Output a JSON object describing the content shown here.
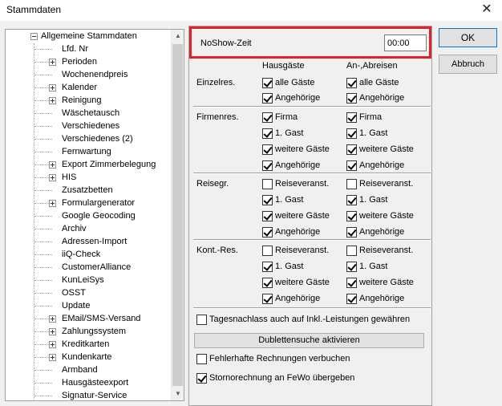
{
  "window": {
    "title": "Stammdaten",
    "close_glyph": "✕"
  },
  "tree": {
    "root": "Allgemeine Stammdaten",
    "items": [
      {
        "label": "Lfd. Nr",
        "expandable": false
      },
      {
        "label": "Perioden",
        "expandable": true
      },
      {
        "label": "Wochenendpreis",
        "expandable": false
      },
      {
        "label": "Kalender",
        "expandable": true
      },
      {
        "label": "Reinigung",
        "expandable": true
      },
      {
        "label": "Wäschetausch",
        "expandable": false
      },
      {
        "label": "Verschiedenes",
        "expandable": false
      },
      {
        "label": "Verschiedenes (2)",
        "expandable": false
      },
      {
        "label": "Fernwartung",
        "expandable": false
      },
      {
        "label": "Export Zimmerbelegung",
        "expandable": true
      },
      {
        "label": "HIS",
        "expandable": true
      },
      {
        "label": "Zusatzbetten",
        "expandable": false
      },
      {
        "label": "Formulargenerator",
        "expandable": true
      },
      {
        "label": "Google Geocoding",
        "expandable": false
      },
      {
        "label": "Archiv",
        "expandable": false
      },
      {
        "label": "Adressen-Import",
        "expandable": false
      },
      {
        "label": "iiQ-Check",
        "expandable": false
      },
      {
        "label": "CustomerAlliance",
        "expandable": false
      },
      {
        "label": "KunLeiSys",
        "expandable": false
      },
      {
        "label": "OSST",
        "expandable": false
      },
      {
        "label": "Update",
        "expandable": false
      },
      {
        "label": "EMail/SMS-Versand",
        "expandable": true
      },
      {
        "label": "Zahlungssystem",
        "expandable": true
      },
      {
        "label": "Kreditkarten",
        "expandable": true
      },
      {
        "label": "Kundenkarte",
        "expandable": true
      },
      {
        "label": "Armband",
        "expandable": false
      },
      {
        "label": "Hausgästeexport",
        "expandable": false
      },
      {
        "label": "Signatur-Service",
        "expandable": false
      }
    ]
  },
  "settings": {
    "noshow_label": "NoShow-Zeit",
    "noshow_value": "00:00",
    "col_hausgaeste": "Hausgäste",
    "col_anabreisen": "An-,Abreisen",
    "sections": [
      {
        "label": "Einzelres.",
        "rows": [
          {
            "haus": {
              "label": "alle Gäste",
              "checked": true
            },
            "an": {
              "label": "alle Gäste",
              "checked": true
            }
          },
          {
            "haus": {
              "label": "Angehörige",
              "checked": true
            },
            "an": {
              "label": "Angehörige",
              "checked": true
            }
          }
        ]
      },
      {
        "label": "Firmenres.",
        "rows": [
          {
            "haus": {
              "label": "Firma",
              "checked": true
            },
            "an": {
              "label": "Firma",
              "checked": true
            }
          },
          {
            "haus": {
              "label": "1. Gast",
              "checked": true
            },
            "an": {
              "label": "1. Gast",
              "checked": true
            }
          },
          {
            "haus": {
              "label": "weitere Gäste",
              "checked": true
            },
            "an": {
              "label": "weitere Gäste",
              "checked": true
            }
          },
          {
            "haus": {
              "label": "Angehörige",
              "checked": true
            },
            "an": {
              "label": "Angehörige",
              "checked": true
            }
          }
        ]
      },
      {
        "label": "Reisegr.",
        "rows": [
          {
            "haus": {
              "label": "Reiseveranst.",
              "checked": false
            },
            "an": {
              "label": "Reiseveranst.",
              "checked": false
            }
          },
          {
            "haus": {
              "label": "1. Gast",
              "checked": true
            },
            "an": {
              "label": "1. Gast",
              "checked": true
            }
          },
          {
            "haus": {
              "label": "weitere Gäste",
              "checked": true
            },
            "an": {
              "label": "weitere Gäste",
              "checked": true
            }
          },
          {
            "haus": {
              "label": "Angehörige",
              "checked": true
            },
            "an": {
              "label": "Angehörige",
              "checked": true
            }
          }
        ]
      },
      {
        "label": "Kont.-Res.",
        "rows": [
          {
            "haus": {
              "label": "Reiseveranst.",
              "checked": false
            },
            "an": {
              "label": "Reiseveranst.",
              "checked": false
            }
          },
          {
            "haus": {
              "label": "1. Gast",
              "checked": true
            },
            "an": {
              "label": "1. Gast",
              "checked": true
            }
          },
          {
            "haus": {
              "label": "weitere Gäste",
              "checked": true
            },
            "an": {
              "label": "weitere Gäste",
              "checked": true
            }
          },
          {
            "haus": {
              "label": "Angehörige",
              "checked": true
            },
            "an": {
              "label": "Angehörige",
              "checked": true
            }
          }
        ]
      }
    ],
    "tagesnachlass": {
      "label": "Tagesnachlass auch auf Inkl.-Leistungen gewähren",
      "checked": false
    },
    "dubletten_button": "Dublettensuche aktivieren",
    "fehlerhafte": {
      "label": "Fehlerhafte Rechnungen verbuchen",
      "checked": false
    },
    "storno": {
      "label": "Stornorechnung an FeWo übergeben",
      "checked": true
    }
  },
  "buttons": {
    "ok": "OK",
    "cancel": "Abbruch"
  },
  "colors": {
    "highlight": "#e0202a",
    "background": "#f0f0f0"
  }
}
